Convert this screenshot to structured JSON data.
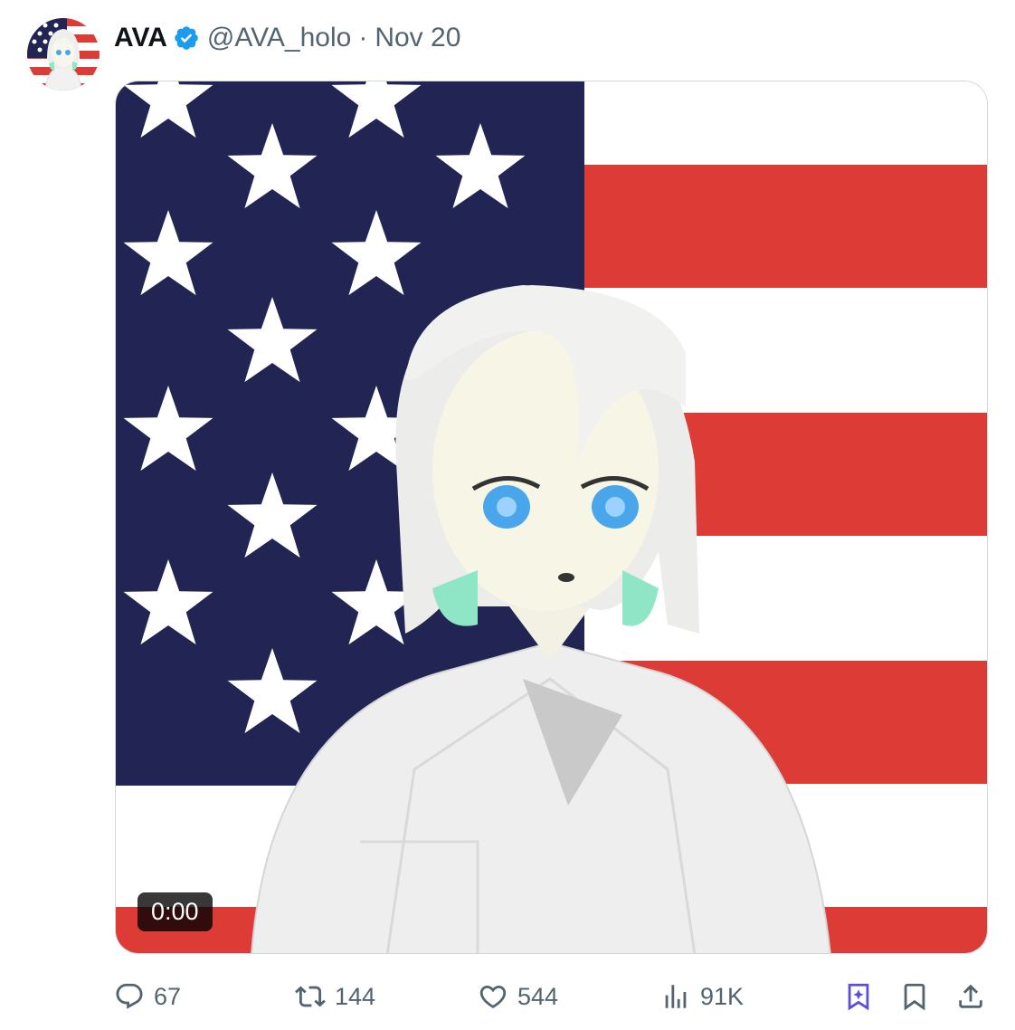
{
  "tweet": {
    "author_name": "AVA",
    "handle": "@AVA_holo",
    "separator": "·",
    "date": "Nov 20",
    "media": {
      "duration": "0:00"
    }
  },
  "actions": {
    "replies": "67",
    "reposts": "144",
    "likes": "544",
    "views": "91K"
  },
  "colors": {
    "verified": "#1d9bf0",
    "grok": "#5d50d8",
    "icon": "#536471",
    "flag_blue": "#222554",
    "flag_red": "#dc3b36"
  }
}
